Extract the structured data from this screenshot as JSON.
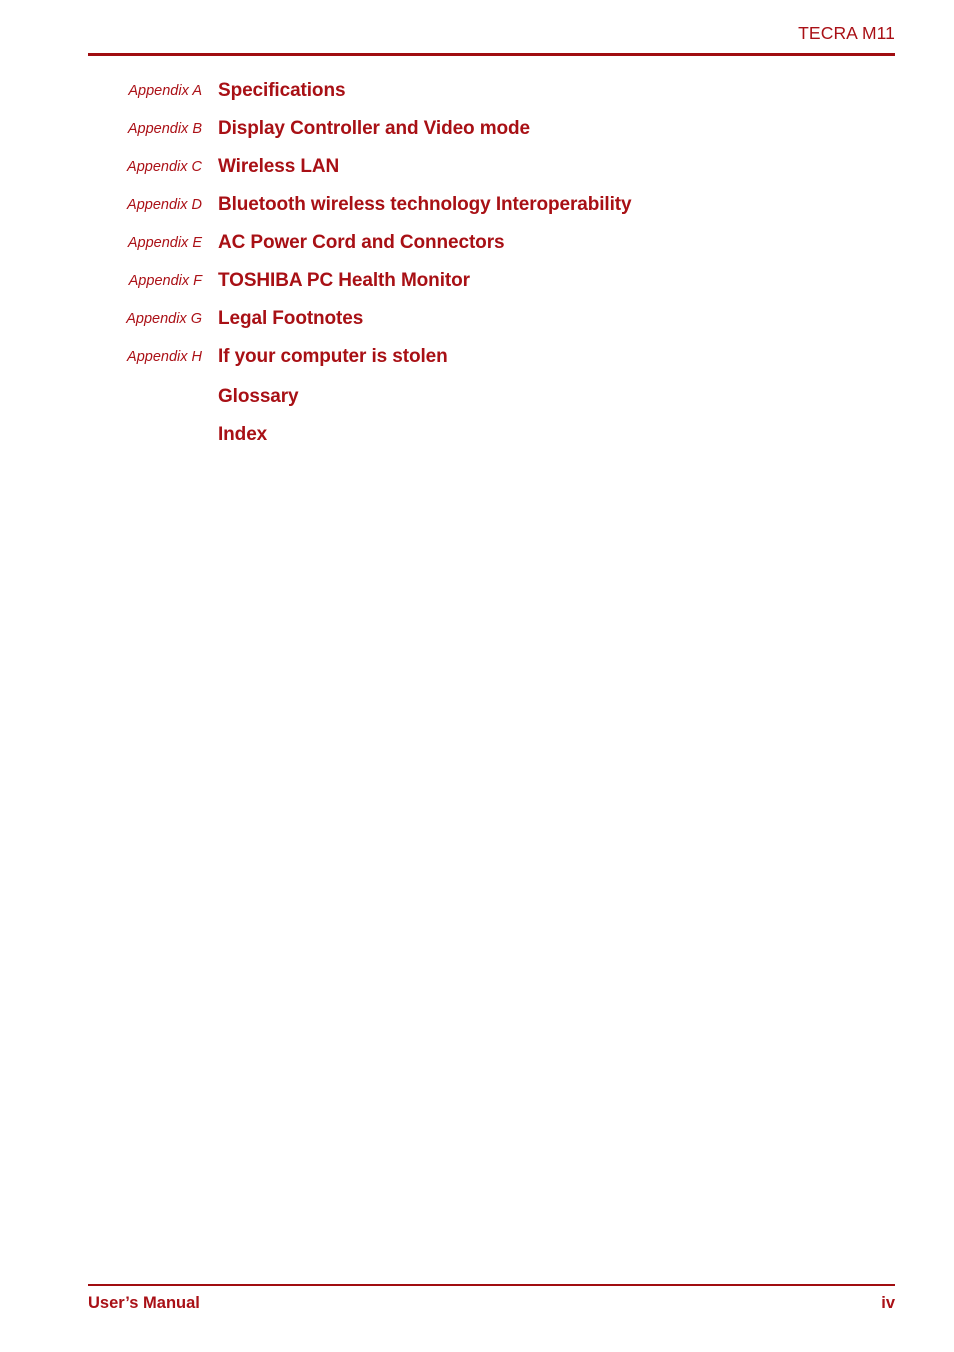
{
  "header": {
    "title": "TECRA M11"
  },
  "contents": {
    "entries": [
      {
        "label": "Appendix A",
        "title": "Specifications"
      },
      {
        "label": "Appendix B",
        "title": "Display Controller and Video mode"
      },
      {
        "label": "Appendix C",
        "title": "Wireless LAN"
      },
      {
        "label": "Appendix D",
        "title": "Bluetooth wireless technology Interoperability"
      },
      {
        "label": "Appendix E",
        "title": "AC Power Cord and Connectors"
      },
      {
        "label": "Appendix F",
        "title": "TOSHIBA PC Health Monitor"
      },
      {
        "label": "Appendix G",
        "title": "Legal Footnotes"
      },
      {
        "label": "Appendix H",
        "title": "If your computer is stolen"
      },
      {
        "label": "",
        "title": "Glossary"
      },
      {
        "label": "",
        "title": "Index"
      }
    ]
  },
  "footer": {
    "document_name": "User’s Manual",
    "page_number": "iv"
  },
  "colors": {
    "accent": "#a91016",
    "rule": "#a00d10",
    "background": "#ffffff"
  }
}
